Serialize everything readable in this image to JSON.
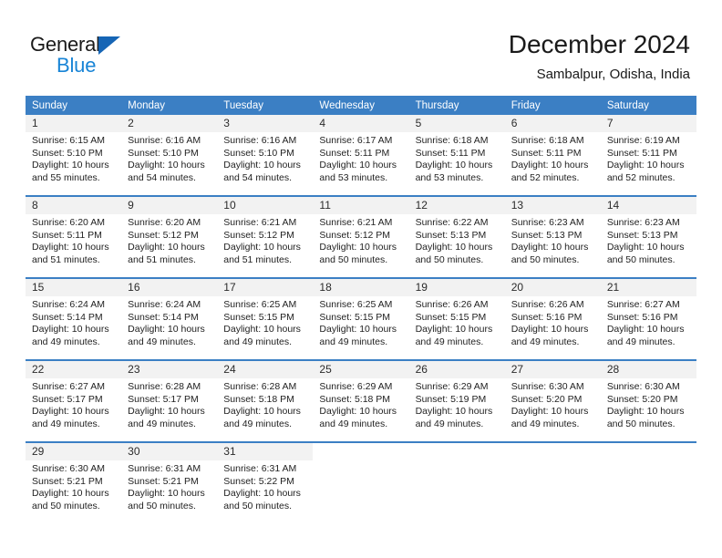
{
  "brand": {
    "name_part1": "General",
    "name_part2": "Blue",
    "triangle_color": "#1665b5",
    "blue_color": "#1884d6"
  },
  "header": {
    "title": "December 2024",
    "subtitle": "Sambalpur, Odisha, India"
  },
  "theme": {
    "header_row_bg": "#3b7fc4",
    "daynum_band_bg": "#f2f2f2",
    "separator_color": "#3b7fc4",
    "text_color": "#222222"
  },
  "weekday_headers": [
    "Sunday",
    "Monday",
    "Tuesday",
    "Wednesday",
    "Thursday",
    "Friday",
    "Saturday"
  ],
  "labels": {
    "sunrise_prefix": "Sunrise:",
    "sunset_prefix": "Sunset:",
    "daylight_prefix": "Daylight:"
  },
  "weeks": [
    [
      {
        "day": "1",
        "sunrise": "Sunrise: 6:15 AM",
        "sunset": "Sunset: 5:10 PM",
        "daylight_line1": "Daylight: 10 hours",
        "daylight_line2": "and 55 minutes."
      },
      {
        "day": "2",
        "sunrise": "Sunrise: 6:16 AM",
        "sunset": "Sunset: 5:10 PM",
        "daylight_line1": "Daylight: 10 hours",
        "daylight_line2": "and 54 minutes."
      },
      {
        "day": "3",
        "sunrise": "Sunrise: 6:16 AM",
        "sunset": "Sunset: 5:10 PM",
        "daylight_line1": "Daylight: 10 hours",
        "daylight_line2": "and 54 minutes."
      },
      {
        "day": "4",
        "sunrise": "Sunrise: 6:17 AM",
        "sunset": "Sunset: 5:11 PM",
        "daylight_line1": "Daylight: 10 hours",
        "daylight_line2": "and 53 minutes."
      },
      {
        "day": "5",
        "sunrise": "Sunrise: 6:18 AM",
        "sunset": "Sunset: 5:11 PM",
        "daylight_line1": "Daylight: 10 hours",
        "daylight_line2": "and 53 minutes."
      },
      {
        "day": "6",
        "sunrise": "Sunrise: 6:18 AM",
        "sunset": "Sunset: 5:11 PM",
        "daylight_line1": "Daylight: 10 hours",
        "daylight_line2": "and 52 minutes."
      },
      {
        "day": "7",
        "sunrise": "Sunrise: 6:19 AM",
        "sunset": "Sunset: 5:11 PM",
        "daylight_line1": "Daylight: 10 hours",
        "daylight_line2": "and 52 minutes."
      }
    ],
    [
      {
        "day": "8",
        "sunrise": "Sunrise: 6:20 AM",
        "sunset": "Sunset: 5:11 PM",
        "daylight_line1": "Daylight: 10 hours",
        "daylight_line2": "and 51 minutes."
      },
      {
        "day": "9",
        "sunrise": "Sunrise: 6:20 AM",
        "sunset": "Sunset: 5:12 PM",
        "daylight_line1": "Daylight: 10 hours",
        "daylight_line2": "and 51 minutes."
      },
      {
        "day": "10",
        "sunrise": "Sunrise: 6:21 AM",
        "sunset": "Sunset: 5:12 PM",
        "daylight_line1": "Daylight: 10 hours",
        "daylight_line2": "and 51 minutes."
      },
      {
        "day": "11",
        "sunrise": "Sunrise: 6:21 AM",
        "sunset": "Sunset: 5:12 PM",
        "daylight_line1": "Daylight: 10 hours",
        "daylight_line2": "and 50 minutes."
      },
      {
        "day": "12",
        "sunrise": "Sunrise: 6:22 AM",
        "sunset": "Sunset: 5:13 PM",
        "daylight_line1": "Daylight: 10 hours",
        "daylight_line2": "and 50 minutes."
      },
      {
        "day": "13",
        "sunrise": "Sunrise: 6:23 AM",
        "sunset": "Sunset: 5:13 PM",
        "daylight_line1": "Daylight: 10 hours",
        "daylight_line2": "and 50 minutes."
      },
      {
        "day": "14",
        "sunrise": "Sunrise: 6:23 AM",
        "sunset": "Sunset: 5:13 PM",
        "daylight_line1": "Daylight: 10 hours",
        "daylight_line2": "and 50 minutes."
      }
    ],
    [
      {
        "day": "15",
        "sunrise": "Sunrise: 6:24 AM",
        "sunset": "Sunset: 5:14 PM",
        "daylight_line1": "Daylight: 10 hours",
        "daylight_line2": "and 49 minutes."
      },
      {
        "day": "16",
        "sunrise": "Sunrise: 6:24 AM",
        "sunset": "Sunset: 5:14 PM",
        "daylight_line1": "Daylight: 10 hours",
        "daylight_line2": "and 49 minutes."
      },
      {
        "day": "17",
        "sunrise": "Sunrise: 6:25 AM",
        "sunset": "Sunset: 5:15 PM",
        "daylight_line1": "Daylight: 10 hours",
        "daylight_line2": "and 49 minutes."
      },
      {
        "day": "18",
        "sunrise": "Sunrise: 6:25 AM",
        "sunset": "Sunset: 5:15 PM",
        "daylight_line1": "Daylight: 10 hours",
        "daylight_line2": "and 49 minutes."
      },
      {
        "day": "19",
        "sunrise": "Sunrise: 6:26 AM",
        "sunset": "Sunset: 5:15 PM",
        "daylight_line1": "Daylight: 10 hours",
        "daylight_line2": "and 49 minutes."
      },
      {
        "day": "20",
        "sunrise": "Sunrise: 6:26 AM",
        "sunset": "Sunset: 5:16 PM",
        "daylight_line1": "Daylight: 10 hours",
        "daylight_line2": "and 49 minutes."
      },
      {
        "day": "21",
        "sunrise": "Sunrise: 6:27 AM",
        "sunset": "Sunset: 5:16 PM",
        "daylight_line1": "Daylight: 10 hours",
        "daylight_line2": "and 49 minutes."
      }
    ],
    [
      {
        "day": "22",
        "sunrise": "Sunrise: 6:27 AM",
        "sunset": "Sunset: 5:17 PM",
        "daylight_line1": "Daylight: 10 hours",
        "daylight_line2": "and 49 minutes."
      },
      {
        "day": "23",
        "sunrise": "Sunrise: 6:28 AM",
        "sunset": "Sunset: 5:17 PM",
        "daylight_line1": "Daylight: 10 hours",
        "daylight_line2": "and 49 minutes."
      },
      {
        "day": "24",
        "sunrise": "Sunrise: 6:28 AM",
        "sunset": "Sunset: 5:18 PM",
        "daylight_line1": "Daylight: 10 hours",
        "daylight_line2": "and 49 minutes."
      },
      {
        "day": "25",
        "sunrise": "Sunrise: 6:29 AM",
        "sunset": "Sunset: 5:18 PM",
        "daylight_line1": "Daylight: 10 hours",
        "daylight_line2": "and 49 minutes."
      },
      {
        "day": "26",
        "sunrise": "Sunrise: 6:29 AM",
        "sunset": "Sunset: 5:19 PM",
        "daylight_line1": "Daylight: 10 hours",
        "daylight_line2": "and 49 minutes."
      },
      {
        "day": "27",
        "sunrise": "Sunrise: 6:30 AM",
        "sunset": "Sunset: 5:20 PM",
        "daylight_line1": "Daylight: 10 hours",
        "daylight_line2": "and 49 minutes."
      },
      {
        "day": "28",
        "sunrise": "Sunrise: 6:30 AM",
        "sunset": "Sunset: 5:20 PM",
        "daylight_line1": "Daylight: 10 hours",
        "daylight_line2": "and 50 minutes."
      }
    ],
    [
      {
        "day": "29",
        "sunrise": "Sunrise: 6:30 AM",
        "sunset": "Sunset: 5:21 PM",
        "daylight_line1": "Daylight: 10 hours",
        "daylight_line2": "and 50 minutes."
      },
      {
        "day": "30",
        "sunrise": "Sunrise: 6:31 AM",
        "sunset": "Sunset: 5:21 PM",
        "daylight_line1": "Daylight: 10 hours",
        "daylight_line2": "and 50 minutes."
      },
      {
        "day": "31",
        "sunrise": "Sunrise: 6:31 AM",
        "sunset": "Sunset: 5:22 PM",
        "daylight_line1": "Daylight: 10 hours",
        "daylight_line2": "and 50 minutes."
      },
      {
        "day": "",
        "sunrise": "",
        "sunset": "",
        "daylight_line1": "",
        "daylight_line2": ""
      },
      {
        "day": "",
        "sunrise": "",
        "sunset": "",
        "daylight_line1": "",
        "daylight_line2": ""
      },
      {
        "day": "",
        "sunrise": "",
        "sunset": "",
        "daylight_line1": "",
        "daylight_line2": ""
      },
      {
        "day": "",
        "sunrise": "",
        "sunset": "",
        "daylight_line1": "",
        "daylight_line2": ""
      }
    ]
  ]
}
